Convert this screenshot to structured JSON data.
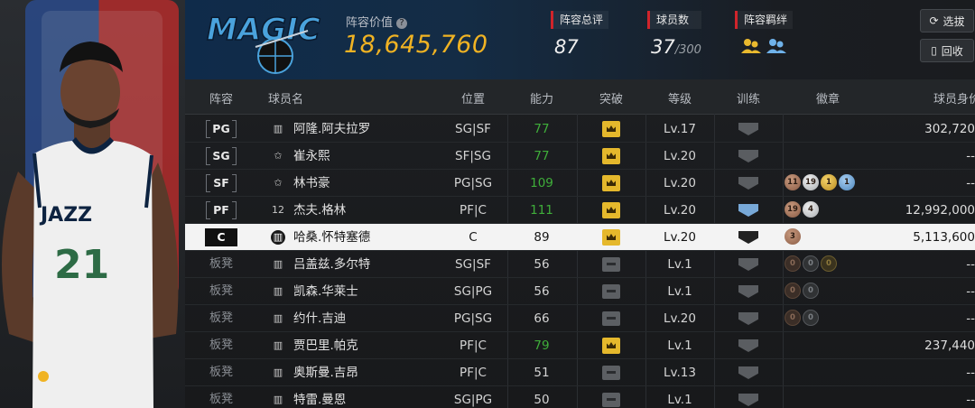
{
  "header": {
    "team_logo_text": "MAGIC",
    "value_label": "阵容价值",
    "help_icon": "?",
    "value_number": "18,645,760",
    "stats": [
      {
        "label": "阵容总评",
        "value": "87",
        "suffix": ""
      },
      {
        "label": "球员数",
        "value": "37",
        "suffix": "/300"
      },
      {
        "label": "阵容羁绊",
        "value": "",
        "suffix": ""
      }
    ],
    "buttons": {
      "select": "选拔",
      "recycle": "回收"
    }
  },
  "player_card": {
    "jersey_team": "JAZZ",
    "jersey_number": "21"
  },
  "table": {
    "columns": [
      "阵容",
      "球员名",
      "位置",
      "能力",
      "突破",
      "等级",
      "训练",
      "徽章",
      "球员身价"
    ],
    "rows": [
      {
        "slot": "PG",
        "tier": "bars",
        "name": "阿隆.阿夫拉罗",
        "position": "SG|SF",
        "rating": "77",
        "rating_color": "green",
        "breakthrough": "on",
        "level": "Lv.17",
        "training": "grey",
        "badges": [],
        "value": "302,720"
      },
      {
        "slot": "SG",
        "tier": "star",
        "name": "崔永熙",
        "position": "SF|SG",
        "rating": "77",
        "rating_color": "green",
        "breakthrough": "on",
        "level": "Lv.20",
        "training": "grey",
        "badges": [],
        "value": "--"
      },
      {
        "slot": "SF",
        "tier": "star",
        "name": "林书豪",
        "position": "PG|SG",
        "rating": "109",
        "rating_color": "green",
        "breakthrough": "on",
        "level": "Lv.20",
        "training": "grey",
        "badges": [
          {
            "t": "bronze",
            "n": "11"
          },
          {
            "t": "silver",
            "n": "19"
          },
          {
            "t": "gold",
            "n": "1"
          },
          {
            "t": "blue",
            "n": "1"
          }
        ],
        "value": "--"
      },
      {
        "slot": "PF",
        "tier": "12",
        "name": "杰夫.格林",
        "position": "PF|C",
        "rating": "111",
        "rating_color": "green",
        "breakthrough": "on",
        "level": "Lv.20",
        "training": "blue",
        "badges": [
          {
            "t": "bronze",
            "n": "19"
          },
          {
            "t": "silver",
            "n": "4"
          }
        ],
        "value": "12,992,000"
      },
      {
        "slot": "C",
        "tier": "bars",
        "name": "哈桑.怀特塞德",
        "position": "C",
        "rating": "89",
        "rating_color": "normal",
        "breakthrough": "on",
        "level": "Lv.20",
        "training": "dark",
        "badges": [
          {
            "t": "bronze",
            "n": "3"
          }
        ],
        "value": "5,113,600",
        "selected": true
      },
      {
        "slot": "板凳",
        "tier": "bars",
        "name": "吕盖兹.多尔特",
        "position": "SG|SF",
        "rating": "56",
        "rating_color": "normal",
        "breakthrough": "off",
        "level": "Lv.1",
        "training": "grey",
        "badges": [
          {
            "t": "empty-bronze",
            "n": "0"
          },
          {
            "t": "empty-silver",
            "n": "0"
          },
          {
            "t": "empty-gold",
            "n": "0"
          }
        ],
        "value": "--"
      },
      {
        "slot": "板凳",
        "tier": "bars",
        "name": "凯森.华莱士",
        "position": "SG|PG",
        "rating": "56",
        "rating_color": "normal",
        "breakthrough": "off",
        "level": "Lv.1",
        "training": "grey",
        "badges": [
          {
            "t": "empty-bronze",
            "n": "0"
          },
          {
            "t": "empty-silver",
            "n": "0"
          }
        ],
        "value": "--"
      },
      {
        "slot": "板凳",
        "tier": "bars",
        "name": "约什.吉迪",
        "position": "PG|SG",
        "rating": "66",
        "rating_color": "normal",
        "breakthrough": "off",
        "level": "Lv.20",
        "training": "grey",
        "badges": [
          {
            "t": "empty-bronze",
            "n": "0"
          },
          {
            "t": "empty-silver",
            "n": "0"
          }
        ],
        "value": "--"
      },
      {
        "slot": "板凳",
        "tier": "bars",
        "name": "贾巴里.帕克",
        "position": "PF|C",
        "rating": "79",
        "rating_color": "green",
        "breakthrough": "on",
        "level": "Lv.1",
        "training": "grey",
        "badges": [],
        "value": "237,440"
      },
      {
        "slot": "板凳",
        "tier": "bars",
        "name": "奥斯曼.吉昂",
        "position": "PF|C",
        "rating": "51",
        "rating_color": "normal",
        "breakthrough": "off",
        "level": "Lv.13",
        "training": "grey",
        "badges": [],
        "value": "--"
      },
      {
        "slot": "板凳",
        "tier": "bars",
        "name": "特雷.曼恩",
        "position": "SG|PG",
        "rating": "50",
        "rating_color": "normal",
        "breakthrough": "off",
        "level": "Lv.1",
        "training": "grey",
        "badges": [],
        "value": "--"
      }
    ]
  }
}
